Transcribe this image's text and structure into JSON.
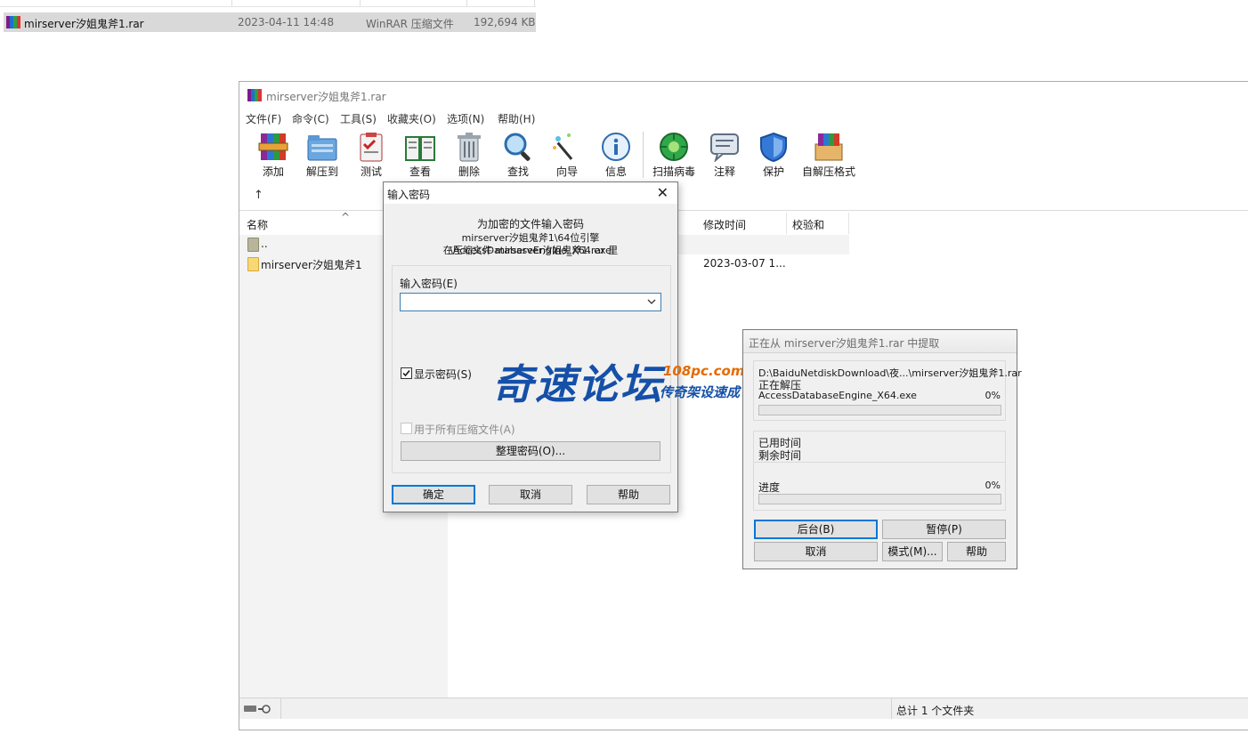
{
  "explorer": {
    "file_name": "mirserver汐姐鬼斧1.rar",
    "modified": "2023-04-11 14:48",
    "type": "WinRAR 压缩文件",
    "size": "192,694 KB"
  },
  "window": {
    "title": "mirserver汐姐鬼斧1.rar",
    "menu": [
      "文件(F)",
      "命令(C)",
      "工具(S)",
      "收藏夹(O)",
      "选项(N)",
      "帮助(H)"
    ],
    "toolbar": [
      {
        "label": "添加",
        "icon": "add-archive-icon"
      },
      {
        "label": "解压到",
        "icon": "extract-folder-icon"
      },
      {
        "label": "测试",
        "icon": "test-clipboard-icon"
      },
      {
        "label": "查看",
        "icon": "view-book-icon"
      },
      {
        "label": "删除",
        "icon": "trash-icon"
      },
      {
        "label": "查找",
        "icon": "magnifier-icon"
      },
      {
        "label": "向导",
        "icon": "wizard-wand-icon"
      },
      {
        "label": "信息",
        "icon": "info-icon"
      },
      {
        "label": "扫描病毒",
        "icon": "virus-scan-icon"
      },
      {
        "label": "注释",
        "icon": "comment-icon"
      },
      {
        "label": "保护",
        "icon": "shield-icon"
      },
      {
        "label": "自解压格式",
        "icon": "sfx-box-icon"
      }
    ],
    "columns": {
      "name": "名称",
      "modified": "修改时间",
      "checksum": "校验和"
    },
    "rows": [
      {
        "name": "..",
        "modified": ""
      },
      {
        "name": "mirserver汐姐鬼斧1",
        "modified": "2023-03-07 1..."
      }
    ],
    "status_text": "总计 1 个文件夹",
    "colors": {
      "accent": "#0078d7",
      "folder": "#f8d775"
    }
  },
  "password_dialog": {
    "title": "输入密码",
    "heading": "为加密的文件输入密码",
    "file_path": "mirserver汐姐鬼斧1\\64位引擎\\AccessDatabaseEngine_X64.exe",
    "archive_line": "在压缩文件 mirserver汐姐鬼斧1.rar 里",
    "field_label": "输入密码(E)",
    "password_value": "",
    "show_password_label": "显示密码(S)",
    "show_password_checked": true,
    "use_all_label": "用于所有压缩文件(A)",
    "use_all_checked": false,
    "organize_button": "整理密码(O)...",
    "ok": "确定",
    "cancel": "取消",
    "help": "帮助"
  },
  "progress_dialog": {
    "title": "正在从 mirserver汐姐鬼斧1.rar 中提取",
    "dest_path": "D:\\BaiduNetdiskDownload\\夜...\\mirserver汐姐鬼斧1.rar",
    "status": "正在解压",
    "current_file": "AccessDatabaseEngine_X64.exe",
    "file_percent": "0%",
    "elapsed_label": "已用时间",
    "remaining_label": "剩余时间",
    "progress_label": "进度",
    "total_percent": "0%",
    "file_progress": 0,
    "total_progress": 0,
    "background": "后台(B)",
    "pause": "暂停(P)",
    "cancel": "取消",
    "mode": "模式(M)...",
    "help": "帮助"
  },
  "watermark": {
    "main": "奇速论坛",
    "domain": "108pc.com",
    "sub": "传奇架设速成"
  }
}
